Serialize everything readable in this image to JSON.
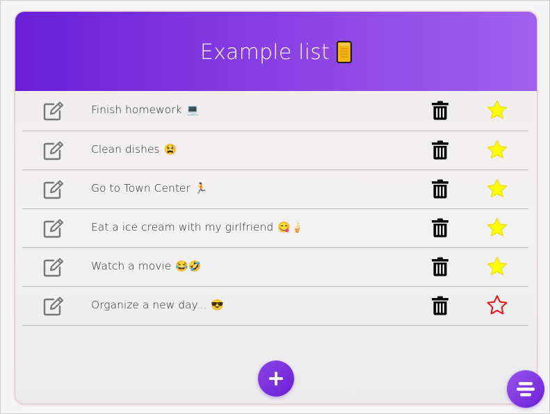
{
  "header": {
    "title": "Example list",
    "title_icon": "notebook-icon",
    "gradient_start": "#6a1fd6",
    "gradient_end": "#a160ee"
  },
  "items": [
    {
      "text": "Finish homework",
      "emoji": "💻",
      "starred": true
    },
    {
      "text": "Clean dishes",
      "emoji": "😫",
      "starred": true
    },
    {
      "text": "Go to Town Center",
      "emoji": "🏃",
      "starred": true
    },
    {
      "text": "Eat a ice cream with my girlfriend",
      "emoji": "😋🍦",
      "starred": true
    },
    {
      "text": "Watch a movie",
      "emoji": "😂🤣",
      "starred": true
    },
    {
      "text": "Organize a new day...",
      "emoji": "😎",
      "starred": false
    }
  ],
  "icons": {
    "edit": "edit-icon",
    "delete": "trash-icon",
    "star_filled": "star-filled-icon",
    "star_outline": "star-outline-icon",
    "add": "plus-icon",
    "menu": "menu-icon"
  },
  "colors": {
    "accent": "#7a2fdf",
    "star_filled": "#ffff00",
    "star_outline": "#ee1111",
    "text": "#2a2a2a"
  }
}
